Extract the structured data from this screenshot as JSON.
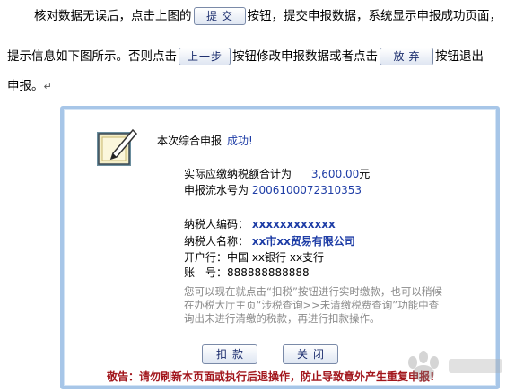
{
  "doc": {
    "line1_before": "核对数据无误后，点击上图的",
    "submit_btn": "提交",
    "line1_after": "按钮，提交申报数据，系统显示申报成功页面，",
    "line2_before": "提示信息如下图所示。否则点击",
    "prev_btn": "上一步",
    "line2_mid": "按钮修改申报数据或者点击",
    "abandon_btn": "放弃",
    "line2_after": "按钮退出",
    "line3": "申报。",
    "para_mark": "↵"
  },
  "panel": {
    "title": "本次综合申报",
    "success": "成功!",
    "tax_label": "实际应缴纳税额合计为",
    "tax_value": "3,600.00",
    "tax_unit": "元",
    "serial_label": "申报流水号为",
    "serial_value": "2006100072310353",
    "taxpayer_id_label": "纳税人编码：",
    "taxpayer_id_value": "xxxxxxxxxxxx",
    "taxpayer_name_label": "纳税人名称：",
    "taxpayer_name_value": "xx市xx贸易有限公司",
    "bank_label": "开户行：",
    "bank_value": "中国 xx银行 xx支行",
    "account_label": "账　号：",
    "account_value": "888888888888",
    "note": "您可以现在就点击“扣税”按钮进行实时缴款，也可以稍候在办税大厅主页“涉税查询>>未清缴税费查询”功能中查询出未进行清缴的税款，再进行扣款操作。",
    "deduct_btn": "扣款",
    "close_btn": "关闭",
    "warning": "敬告：请勿刷新本页面或执行后退操作，防止导致意外产生重复申报!"
  },
  "colors": {
    "panel_border": "#a7c6e8",
    "blue_text": "#1e3da6",
    "warning": "#a2161c",
    "note": "#8b8b8b"
  },
  "icons": [
    "edit-document-icon",
    "baidu-watermark-icon"
  ]
}
